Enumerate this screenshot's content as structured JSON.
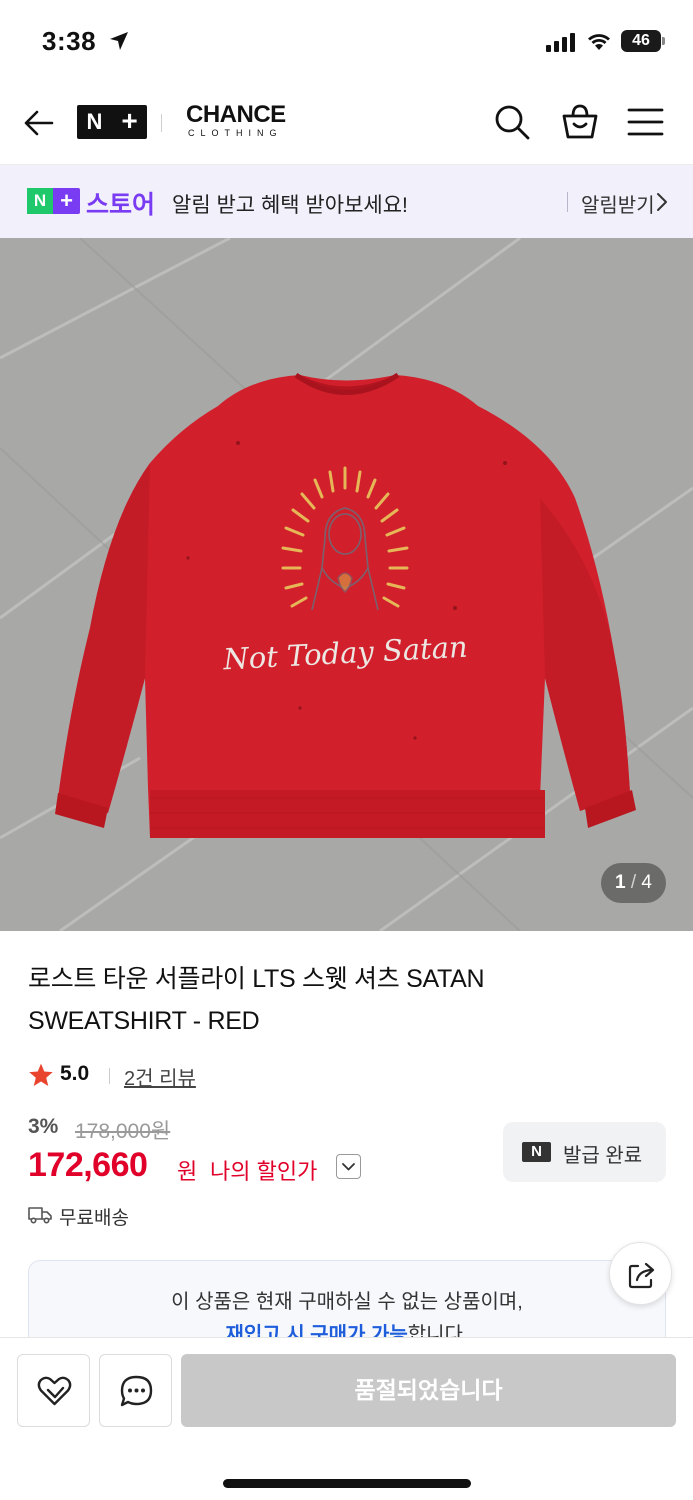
{
  "status_bar": {
    "time": "3:38",
    "battery": "46"
  },
  "header": {
    "logo_n": "N",
    "logo_plus": "+",
    "brand_main": "CHANCE",
    "brand_sub": "CLOTHING"
  },
  "banner": {
    "logo_n": "N",
    "logo_plus": "+",
    "store": "스토어",
    "text": "알림 받고 혜택 받아보세요!",
    "action": "알림받기"
  },
  "product": {
    "image_text": "Not Today Satan",
    "page_current": "1",
    "page_separator": "/",
    "page_total": "4",
    "title": "로스트 타운 서플라이 LTS 스웻 셔츠 SATAN SWEATSHIRT - RED",
    "rating": "5.0",
    "reviews": "2건 리뷰",
    "discount_rate": "3%",
    "original_price": "178,000원",
    "sale_price": "172,660",
    "currency": "원",
    "my_discount": "나의 할인가",
    "coupon_logo": "N",
    "coupon_label": "발급 완료",
    "shipping": "무료배송"
  },
  "notice": {
    "line1": "이 상품은 현재 구매하실 수 없는 상품이며,",
    "link": "재입고 시 구매가 가능",
    "line2_suffix": "합니다."
  },
  "bottom_bar": {
    "soldout_label": "품절되었습니다"
  },
  "colors": {
    "price_red": "#e0002a",
    "brand_purple": "#7a3cf2",
    "naver_green": "#1fc96b",
    "link_blue": "#1e5edb"
  }
}
